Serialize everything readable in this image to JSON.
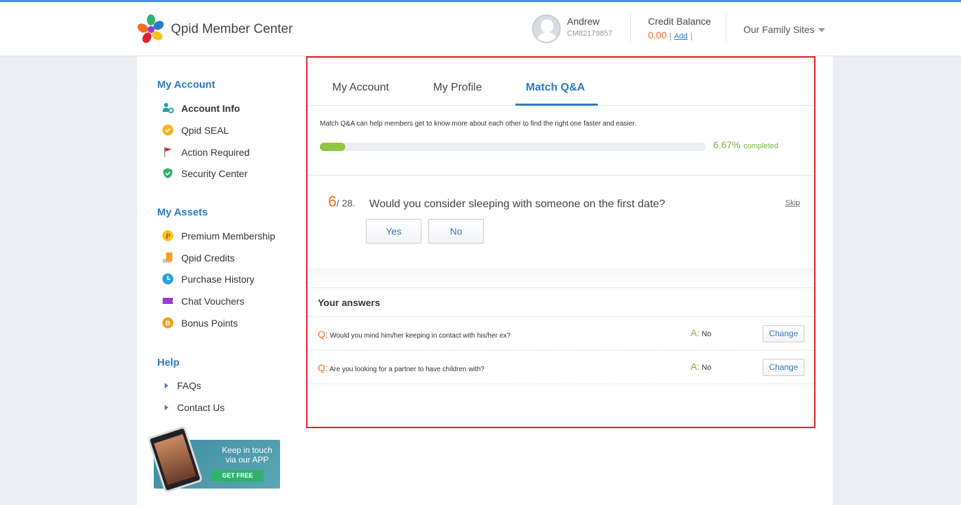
{
  "header": {
    "brand": "Qpid Member Center",
    "user_name": "Andrew",
    "user_id": "CM82179857",
    "credit_label": "Credit Balance",
    "credit_value": "0.00",
    "credit_add_open": "[",
    "credit_add": "Add",
    "credit_add_close": "]",
    "family_sites": "Our Family Sites"
  },
  "sidebar": {
    "sections": [
      {
        "title": "My Account",
        "items": [
          "Account Info",
          "Qpid SEAL",
          "Action Required",
          "Security Center"
        ]
      },
      {
        "title": "My Assets",
        "items": [
          "Premium Membership",
          "Qpid Credits",
          "Purchase History",
          "Chat Vouchers",
          "Bonus Points"
        ]
      },
      {
        "title": "Help",
        "items": [
          "FAQs",
          "Contact Us"
        ]
      }
    ],
    "banner": {
      "line1": "Keep in touch",
      "line2": "via our APP",
      "button": "GET FREE"
    }
  },
  "tabs": [
    "My Account",
    "My Profile",
    "Match Q&A"
  ],
  "active_tab": "Match Q&A",
  "qa": {
    "description": "Match Q&A can help members get to know more about each other to find the right one faster and easier.",
    "progress_percent": 6.67,
    "progress_value": "6.67%",
    "progress_label": "completed",
    "current_number": "6",
    "total": "/ 28.",
    "question": "Would you consider sleeping with someone on the first date?",
    "skip": "Skip",
    "yes": "Yes",
    "no": "No"
  },
  "answers": {
    "title": "Your answers",
    "q_tag": "Q:",
    "a_tag": "A:",
    "change_label": "Change",
    "rows": [
      {
        "question": "Would you mind him/her keeping in contact with his/her ex?",
        "answer": "No"
      },
      {
        "question": "Are you looking for a partner to have children with?",
        "answer": "No"
      }
    ]
  },
  "colors": {
    "accent": "#2a7ac0",
    "orange": "#f76b1c",
    "green": "#8cc63f",
    "highlight_border": "#e0202a"
  }
}
